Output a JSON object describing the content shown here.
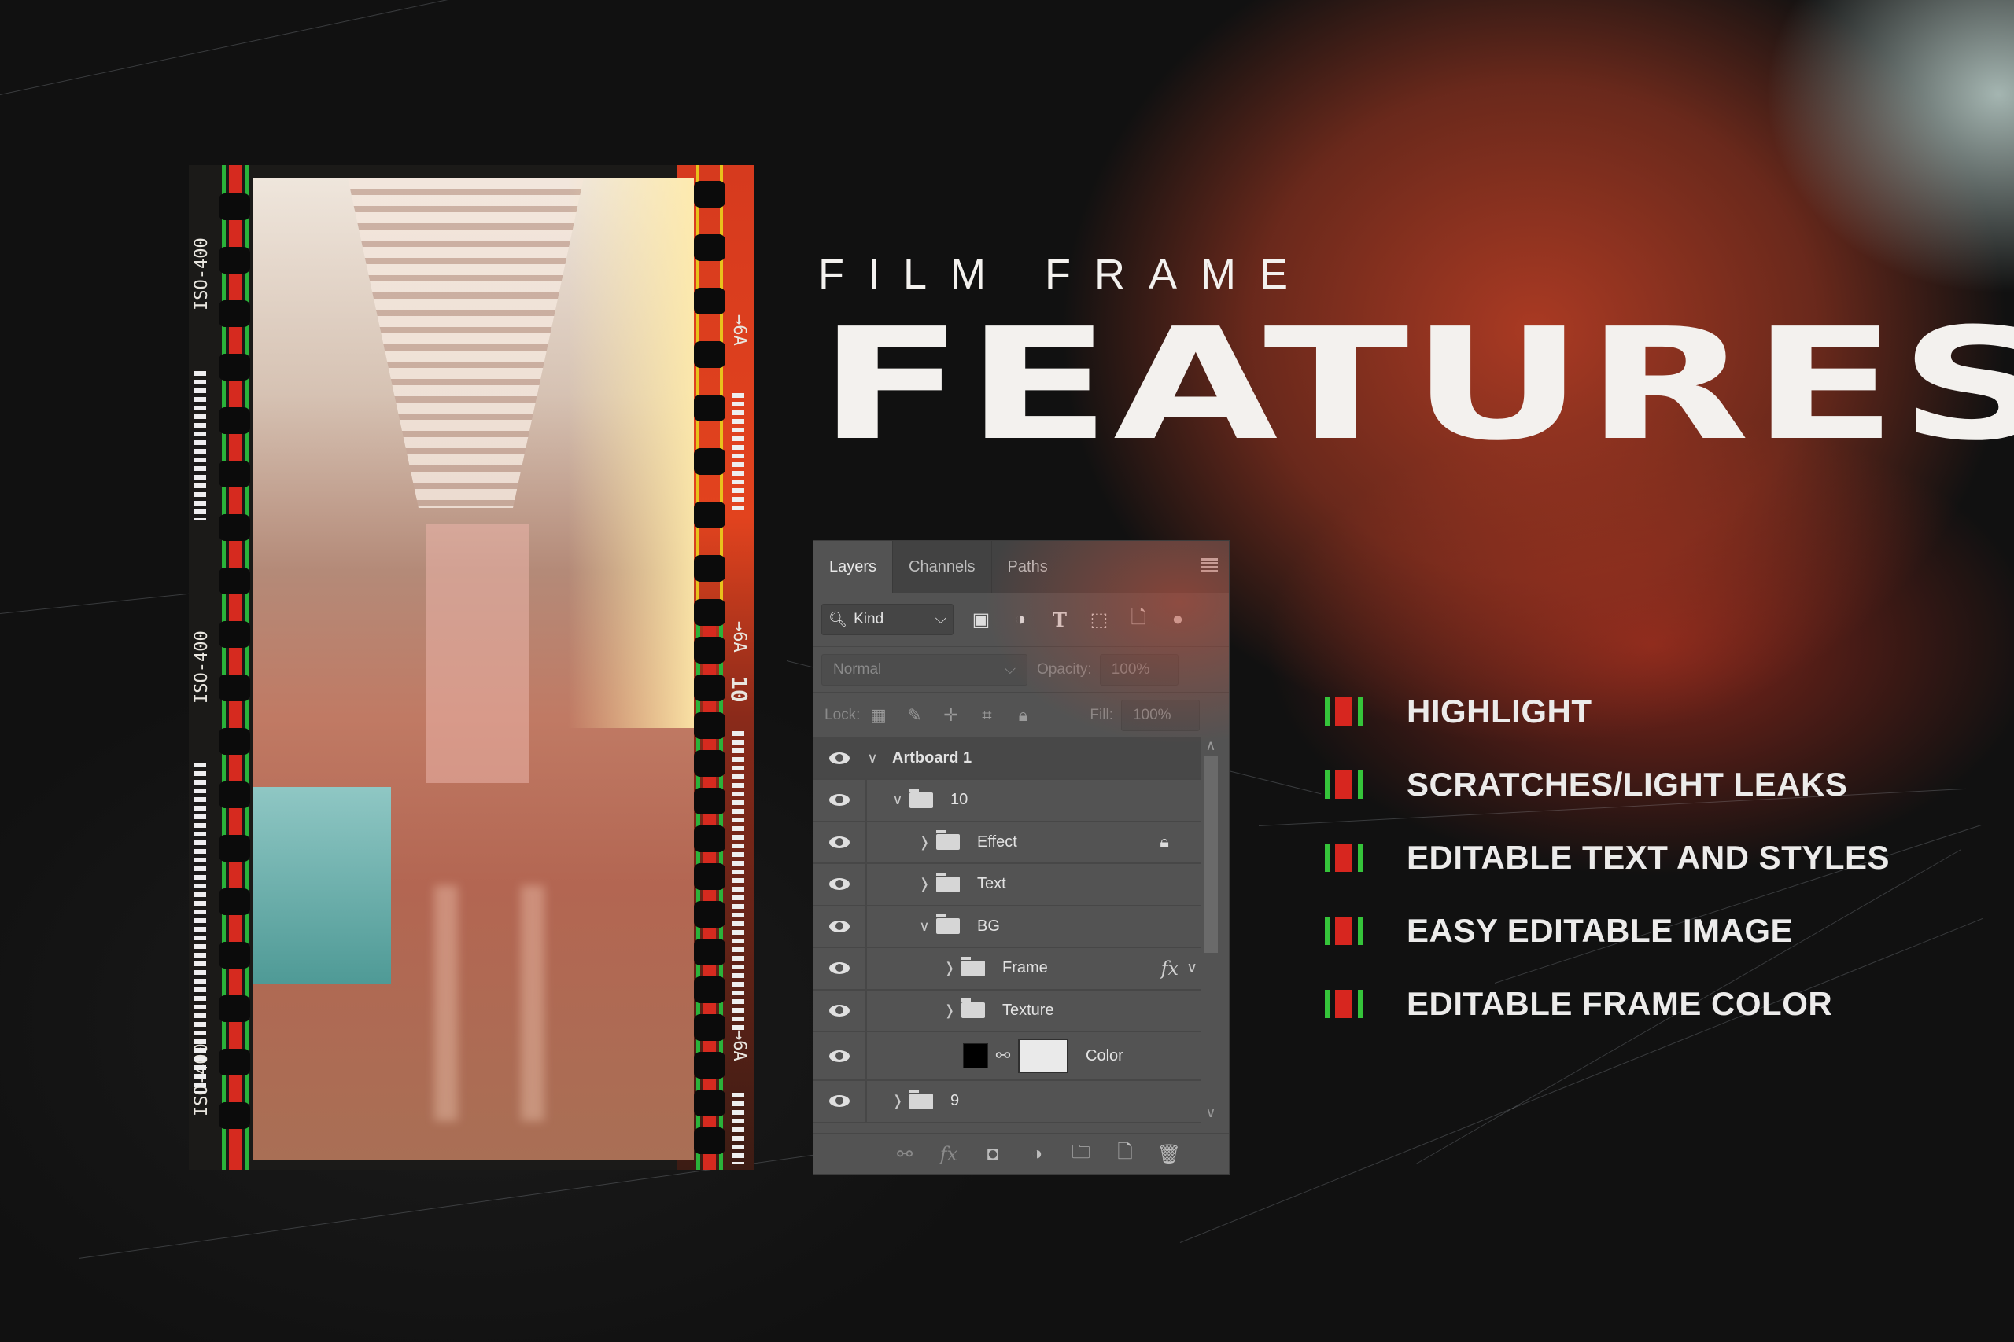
{
  "heading": {
    "eyebrow": "FILM FRAME",
    "title": "FEATURES"
  },
  "colors": {
    "bullet_green": "#35c43a",
    "bullet_red": "#d7261f",
    "panel_bg": "#535353",
    "accent_red_glow": "#b23c24"
  },
  "features": [
    {
      "label": "HIGHLIGHT"
    },
    {
      "label": "SCRATCHES/LIGHT LEAKS"
    },
    {
      "label": "EDITABLE TEXT AND STYLES"
    },
    {
      "label": "EASY EDITABLE IMAGE"
    },
    {
      "label": "EDITABLE FRAME COLOR"
    }
  ],
  "film_strip": {
    "left_labels": [
      "ISO-400",
      "ISO-400",
      "ISO-400"
    ],
    "right_labels": [
      "→6A",
      "→6A",
      "10",
      "→6A"
    ]
  },
  "layers_panel": {
    "tabs": [
      {
        "label": "Layers",
        "active": true
      },
      {
        "label": "Channels",
        "active": false
      },
      {
        "label": "Paths",
        "active": false
      }
    ],
    "filter": {
      "kind_label": "Kind"
    },
    "blend_mode": "Normal",
    "opacity_label": "Opacity:",
    "opacity_value": "100%",
    "lock_label": "Lock:",
    "fill_label": "Fill:",
    "fill_value": "100%",
    "layers": [
      {
        "name": "Artboard 1",
        "type": "artboard",
        "expanded": true,
        "visible": true
      },
      {
        "name": "10",
        "type": "group",
        "expanded": true,
        "visible": true,
        "depth": 1
      },
      {
        "name": "Effect",
        "type": "group",
        "expanded": false,
        "visible": true,
        "depth": 2,
        "locked": true
      },
      {
        "name": "Text",
        "type": "group",
        "expanded": false,
        "visible": true,
        "depth": 2
      },
      {
        "name": "BG",
        "type": "group",
        "expanded": true,
        "visible": true,
        "depth": 2
      },
      {
        "name": "Frame",
        "type": "group",
        "expanded": false,
        "visible": true,
        "depth": 3,
        "fx": "fx"
      },
      {
        "name": "Texture",
        "type": "group",
        "expanded": false,
        "visible": true,
        "depth": 3
      },
      {
        "name": "Color",
        "type": "fill-layer",
        "visible": true,
        "depth": 3
      },
      {
        "name": "9",
        "type": "group",
        "expanded": false,
        "visible": true,
        "depth": 1
      }
    ]
  }
}
